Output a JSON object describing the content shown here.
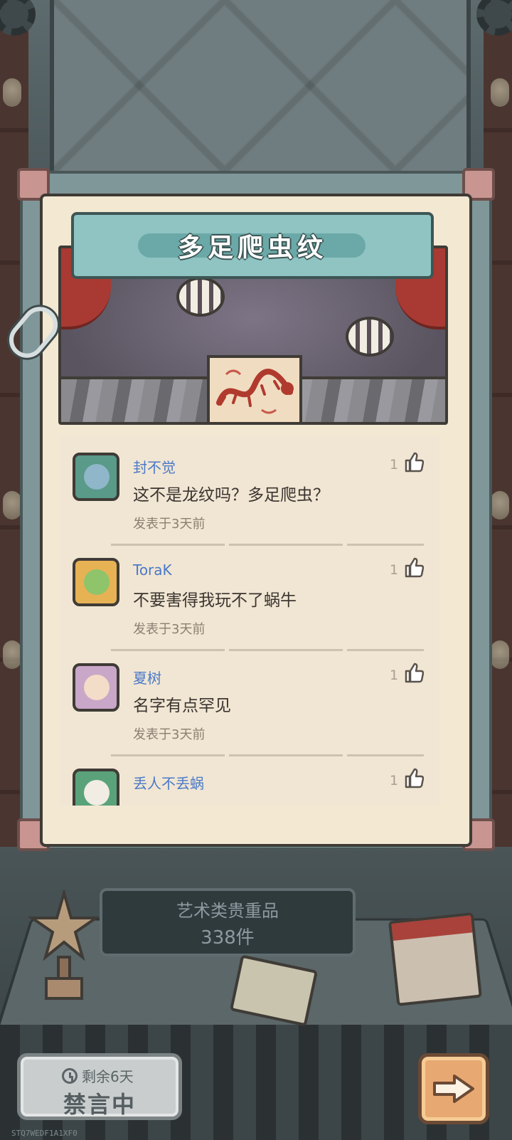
{
  "exhibit": {
    "title": "多足爬虫纹"
  },
  "comments": [
    {
      "username": "封不觉",
      "text": "这不是龙纹吗？多足爬虫？",
      "time": "发表于3天前",
      "likes": "1",
      "avatar_color": "#5a9a88"
    },
    {
      "username": "ToraK",
      "text": "不要害得我玩不了蜗牛",
      "time": "发表于3天前",
      "likes": "1",
      "avatar_color": "#e7b254"
    },
    {
      "username": "夏树",
      "text": "名字有点罕见",
      "time": "发表于3天前",
      "likes": "1",
      "avatar_color": "#c9a7c8"
    },
    {
      "username": "丢人不丢蜗",
      "text": "",
      "time": "",
      "likes": "1",
      "avatar_color": "#5aa37a"
    }
  ],
  "collection": {
    "name": "艺术类贵重品",
    "count": "338件"
  },
  "mute": {
    "remaining": "剩余6天",
    "status": "禁言中"
  },
  "debug_id": "STQ7WEDF1A1XF0"
}
